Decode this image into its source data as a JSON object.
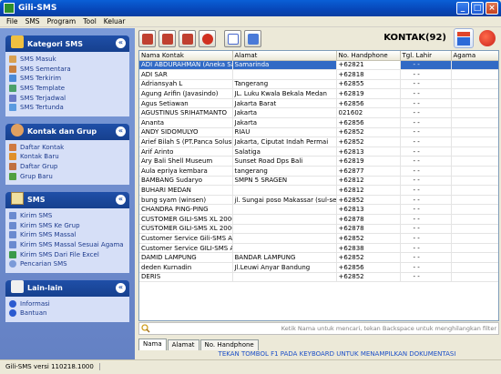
{
  "window": {
    "title": "Gili-SMS"
  },
  "menu": [
    "File",
    "SMS",
    "Program",
    "Tool",
    "Keluar"
  ],
  "sidebar": {
    "panels": [
      {
        "title": "Kategori SMS",
        "items": [
          "SMS Masuk",
          "SMS Sementara",
          "SMS Terkirim",
          "SMS Template",
          "SMS Terjadwal",
          "SMS Tertunda"
        ]
      },
      {
        "title": "Kontak dan Grup",
        "items": [
          "Daftar Kontak",
          "Kontak Baru",
          "Daftar Grup",
          "Grup Baru"
        ]
      },
      {
        "title": "SMS",
        "items": [
          "Kirim SMS",
          "Kirim SMS Ke Grup",
          "Kirim SMS Massal",
          "Kirim SMS Massal Sesuai Agama",
          "Kirim SMS Dari File Excel",
          "Pencarian SMS"
        ]
      },
      {
        "title": "Lain-lain",
        "items": [
          "Informasi",
          "Bantuan"
        ]
      }
    ]
  },
  "header": {
    "count_label": "KONTAK(92)"
  },
  "table": {
    "columns": [
      "Nama Kontak",
      "Alamat",
      "No. Handphone",
      "Tgl. Lahir",
      "Agama"
    ],
    "rows": [
      [
        "ADI ABDURAHMAN (Aneka Sa",
        "Samarinda",
        "+62821",
        "- -",
        ""
      ],
      [
        "ADI SAR",
        "",
        "+62818",
        "- -",
        ""
      ],
      [
        "Adriansyah L",
        "Tangerang",
        "+62855",
        "- -",
        ""
      ],
      [
        "Agung Arifin (Javasindo)",
        "JL. Luku Kwala Bekala Medan",
        "+62819",
        "- -",
        ""
      ],
      [
        "Agus Setiawan",
        "Jakarta Barat",
        "+62856",
        "- -",
        ""
      ],
      [
        "AGUSTINUS SRIHATMANTO",
        "Jakarta",
        "021602",
        "- -",
        ""
      ],
      [
        "Ananta",
        "Jakarta",
        "+62856",
        "- -",
        ""
      ],
      [
        "ANDY SIDOMULYO",
        "RIAU",
        "+62852",
        "- -",
        ""
      ],
      [
        "Arief Bilah S (PT.Panca Solusi",
        "Jakarta, Ciputat Indah Permai",
        "+62852",
        "- -",
        ""
      ],
      [
        "Arif Arinto",
        "Salatiga",
        "+62813",
        "- -",
        ""
      ],
      [
        "Ary Bali Shell Museum",
        "Sunset Road Dps Bali",
        "+62819",
        "- -",
        ""
      ],
      [
        "Aula epriya kembara",
        "tangerang",
        "+62877",
        "- -",
        ""
      ],
      [
        "BAMBANG Sudaryo",
        "SMPN 5 SRAGEN",
        "+62812",
        "- -",
        ""
      ],
      [
        "BUHARI MEDAN",
        "",
        "+62812",
        "- -",
        ""
      ],
      [
        "bung syam (winsen)",
        "jl. Sungai poso Makassar (sul-sel)",
        "+62852",
        "- -",
        ""
      ],
      [
        "CHANDRA PING-PING",
        "",
        "+62813",
        "- -",
        ""
      ],
      [
        "CUSTOMER GILI-SMS XL 2000",
        "",
        "+62878",
        "- -",
        ""
      ],
      [
        "CUSTOMER GILI-SMS XL 2000",
        "",
        "+62878",
        "- -",
        ""
      ],
      [
        "Customer Service Gili-SMS AS",
        "",
        "+62852",
        "- -",
        ""
      ],
      [
        "Customer Service GILI-SMS A",
        "",
        "+62838",
        "- -",
        ""
      ],
      [
        "DAMID LAMPUNG",
        "BANDAR LAMPUNG",
        "+62852",
        "- -",
        ""
      ],
      [
        "deden Kurnadin",
        "Jl.Leuwi Anyar Bandung",
        "+62856",
        "- -",
        ""
      ],
      [
        "DERIS",
        "",
        "+62852",
        "- -",
        ""
      ]
    ]
  },
  "search": {
    "hint": "Ketik Nama untuk mencari, tekan Backspace untuk menghilangkan filter"
  },
  "tabs": [
    "Nama",
    "Alamat",
    "No. Handphone"
  ],
  "footer_message": "TEKAN TOMBOL F1 PADA KEYBOARD UNTUK MENAMPILKAN DOKUMENTASI",
  "status": {
    "version": "Gili-SMS versi 110218.1000"
  },
  "colors": {
    "sidebar_bg": "#6f8dcf",
    "panel_head": "#1f4fa8",
    "selection": "#316ac5",
    "link": "#1c3a8c"
  }
}
